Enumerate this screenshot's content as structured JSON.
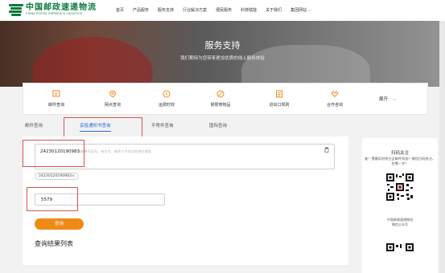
{
  "header": {
    "logo_cn": "中国邮政速递物流",
    "logo_en": "CHINA POSTAL EXPRESS & LOGISTICS",
    "nav": [
      "首页",
      "产品服务",
      "服务支持",
      "行业解决方案",
      "便民服务",
      "科技赋能",
      "关于我们",
      "集团网站"
    ]
  },
  "hero": {
    "title": "服务支持",
    "subtitle": "我们期待为您带来更加优质的线上服务体验"
  },
  "services": {
    "items": [
      {
        "label": "邮件查询",
        "icon": "mail-search-icon"
      },
      {
        "label": "网点查询",
        "icon": "location-icon"
      },
      {
        "label": "运费时效",
        "icon": "price-time-icon"
      },
      {
        "label": "禁限寄物品",
        "icon": "prohibited-icon"
      },
      {
        "label": "进出口规则",
        "icon": "customs-icon"
      },
      {
        "label": "合作咨询",
        "icon": "handshake-icon"
      }
    ],
    "more_label": "展开"
  },
  "tabs": {
    "items": [
      "邮件查询",
      "妥投通知书查询",
      "平常件查询",
      "国际查询"
    ],
    "active_index": 1
  },
  "form": {
    "tracking_value": "24230120190983",
    "tracking_placeholder": "根据单号证号、有生号、邮件人手机号码进行搜索",
    "chip_label": "24230120190983×",
    "code_value": "5579",
    "query_button": "查询",
    "result_title": "查询结果列表"
  },
  "side": {
    "title": "扫码关注",
    "text": "查！惯最实时关注全邮件状态？微信扫码关注，仅需一步！",
    "qr_caption_1": "中国邮政速递物流",
    "qr_caption_2": "微信公众号"
  },
  "colors": {
    "brand_green": "#0a7a3a",
    "accent_orange": "#f08a17",
    "active_blue": "#2a6ad6",
    "highlight_red": "#d9534f"
  }
}
